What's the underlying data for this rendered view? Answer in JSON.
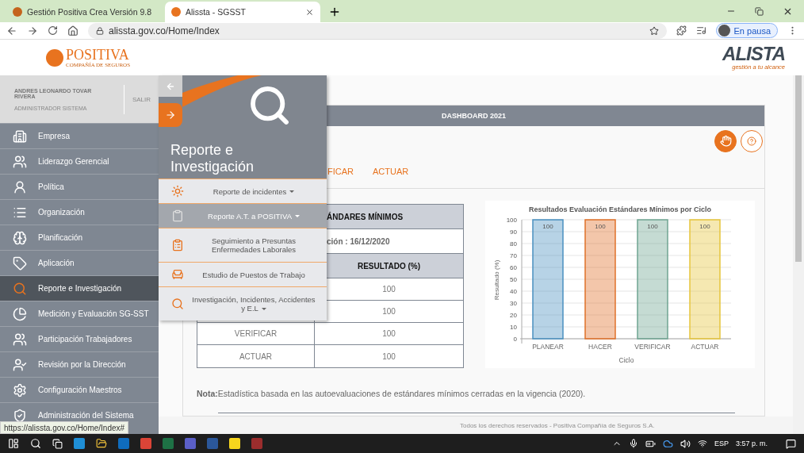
{
  "browser": {
    "tabs": [
      {
        "title": "Gestión Positiva Crea Versión 9.8",
        "selected": false
      },
      {
        "title": "Alissta - SGSST",
        "selected": true
      }
    ],
    "address": "alissta.gov.co/Home/Index",
    "profile": "En pausa"
  },
  "header": {
    "brand": "POSITIVA",
    "brand_sub": "COMPAÑÍA DE SEGUROS",
    "app_logo": "ALISTA",
    "app_tagline": "gestión a tu alcance"
  },
  "user": {
    "name": "ANDRES LEONARDO TOVAR RIVERA",
    "role": "ADMINISTRADOR SISTEMA",
    "logout": "SALIR"
  },
  "sidebar": {
    "items": [
      {
        "label": "Empresa",
        "selected": false
      },
      {
        "label": "Liderazgo Gerencial",
        "selected": false
      },
      {
        "label": "Política",
        "selected": false
      },
      {
        "label": "Organización",
        "selected": false
      },
      {
        "label": "Planificación",
        "selected": false
      },
      {
        "label": "Aplicación",
        "selected": false
      },
      {
        "label": "Reporte e Investigación",
        "selected": true
      },
      {
        "label": "Medición y Evaluación SG-SST",
        "selected": false
      },
      {
        "label": "Participación Trabajadores",
        "selected": false
      },
      {
        "label": "Revisión por la Dirección",
        "selected": false
      },
      {
        "label": "Configuración Maestros",
        "selected": false
      },
      {
        "label": "Administración del Sistema",
        "selected": false
      }
    ]
  },
  "flyout": {
    "title": "Reporte e Investigación",
    "items": [
      {
        "label": "Reporte de incidentes",
        "dropdown": true,
        "selected": false
      },
      {
        "label": "Reporte A.T. a POSITIVA",
        "dropdown": true,
        "selected": true
      },
      {
        "label": "Seguimiento a Presuntas Enfermedades Laborales",
        "dropdown": false,
        "selected": false
      },
      {
        "label": "Estudio de Puestos de Trabajo",
        "dropdown": false,
        "selected": false
      },
      {
        "label": "Investigación, Incidentes, Accidentes y E.L",
        "dropdown": true,
        "selected": false
      }
    ]
  },
  "dashboard": {
    "title": "DASHBOARD 2021",
    "tabs": [
      {
        "label": "FICAR",
        "selected": false
      },
      {
        "label": "ACTUAR",
        "selected": false
      }
    ],
    "table": {
      "title": "ÁNDARES MÍNIMOS",
      "date": "ción : 16/12/2020",
      "columns": [
        "RESULTADO (%)"
      ],
      "rows": [
        {
          "result": "100"
        },
        {
          "result": "100"
        },
        {
          "cycle": "VERIFICAR",
          "result": "100"
        },
        {
          "cycle": "ACTUAR",
          "result": "100"
        }
      ]
    },
    "chart_data": {
      "type": "bar",
      "title": "Resultados Evaluación Estándares Mínimos por Ciclo",
      "xlabel": "Ciclo",
      "ylabel": "Resultado (%)",
      "categories": [
        "PLANEAR",
        "HACER",
        "VERIFICAR",
        "ACTUAR"
      ],
      "values": [
        100,
        100,
        100,
        100
      ],
      "colors": [
        "#4a90c0",
        "#e0712a",
        "#6fa592",
        "#e6c53b"
      ],
      "grid": true,
      "ylim": [
        0,
        100
      ],
      "yticks": [
        0,
        10,
        20,
        30,
        40,
        50,
        60,
        70,
        80,
        90,
        100
      ],
      "data_labels": true
    },
    "note": "**Nota:**Estadística basada en las autoevaluaciones de estándares mínimos cerradas en la vigencia (2020)."
  },
  "footer": "Todos los derechos reservados - Positiva Compañía de Seguros S.A.",
  "status_url": "https://alissta.gov.co/Home/Index#",
  "taskbar": {
    "language": "ESP",
    "time": "3:57 p. m."
  }
}
